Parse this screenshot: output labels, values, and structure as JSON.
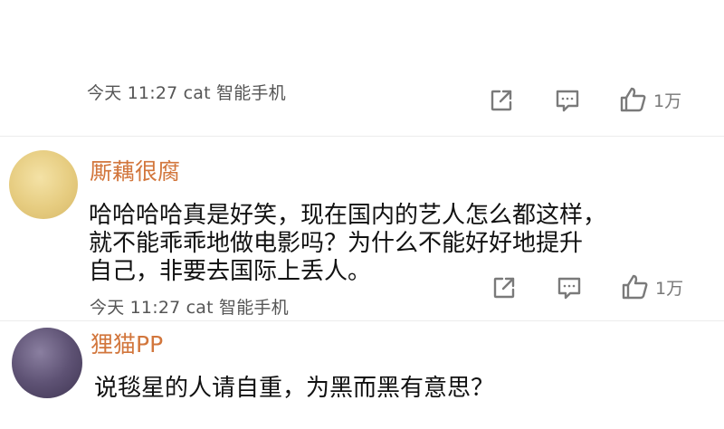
{
  "comments": [
    {
      "meta": "今天 11:27 cat 智能手机",
      "likes": "1万"
    },
    {
      "username": "厮藕很腐",
      "text_lines": [
        "哈哈哈哈真是好笑，现在国内的艺人怎么都这样，",
        "就不能乖乖地做电影吗？为什么不能好好地提升",
        "自己，非要去国际上丢人。"
      ],
      "meta": "今天 11:27 cat 智能手机",
      "likes": "1万",
      "avatar_color": "#e7cf86"
    },
    {
      "username": "狸猫PP",
      "text_lines": [
        "说毯星的人请自重，为黑而黑有意思？"
      ],
      "avatar_color": "#5b4f6e"
    }
  ],
  "colors": {
    "username": "#d2763c",
    "meta": "#555555",
    "icon": "#777777"
  },
  "icons": {
    "share": "share-icon",
    "comment": "comment-icon",
    "like": "thumbs-up-icon"
  }
}
